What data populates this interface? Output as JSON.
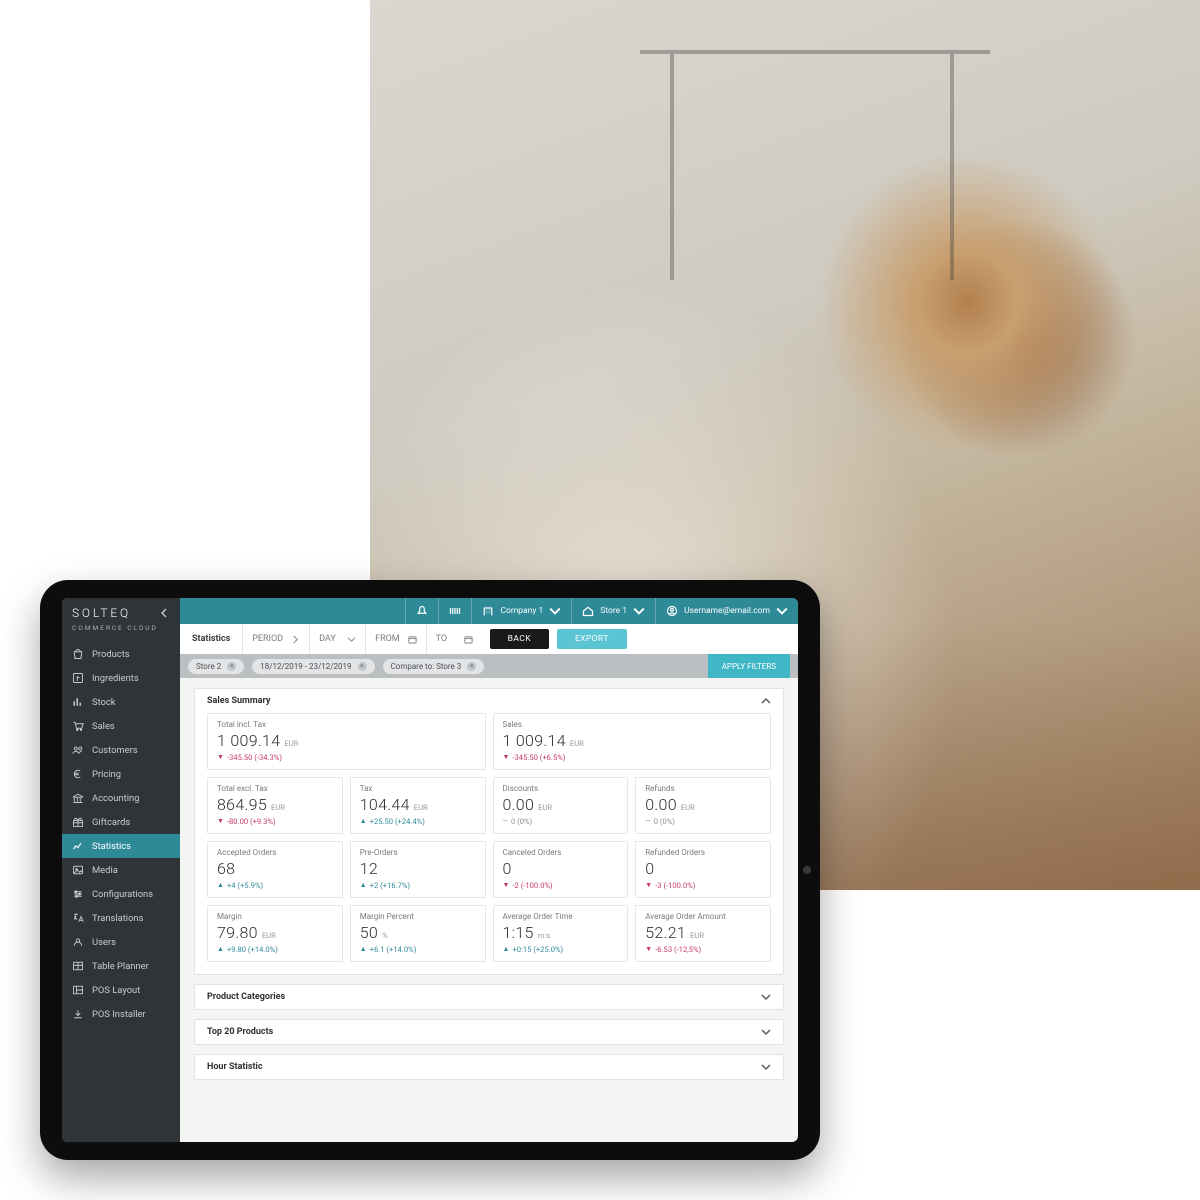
{
  "brand": {
    "title": "SOLTEQ",
    "subtitle": "COMMERCE CLOUD"
  },
  "sidebar": {
    "items": [
      {
        "label": "Products",
        "icon": "bag-icon"
      },
      {
        "label": "Ingredients",
        "icon": "ingredients-icon"
      },
      {
        "label": "Stock",
        "icon": "bars-icon"
      },
      {
        "label": "Sales",
        "icon": "cart-icon"
      },
      {
        "label": "Customers",
        "icon": "people-icon"
      },
      {
        "label": "Pricing",
        "icon": "euro-icon"
      },
      {
        "label": "Accounting",
        "icon": "bank-icon"
      },
      {
        "label": "Giftcards",
        "icon": "gift-icon"
      },
      {
        "label": "Statistics",
        "icon": "chart-line-icon"
      },
      {
        "label": "Media",
        "icon": "image-icon"
      },
      {
        "label": "Configurations",
        "icon": "sliders-icon"
      },
      {
        "label": "Translations",
        "icon": "translate-icon"
      },
      {
        "label": "Users",
        "icon": "user-icon"
      },
      {
        "label": "Table Planner",
        "icon": "table-icon"
      },
      {
        "label": "POS Layout",
        "icon": "layout-icon"
      },
      {
        "label": "POS Installer",
        "icon": "download-icon"
      }
    ],
    "active_index": 8
  },
  "topbar": {
    "company_label": "Company 1",
    "store_label": "Store 1",
    "user_label": "Username@email.com"
  },
  "filterbar": {
    "page_title": "Statistics",
    "period_label": "PERIOD",
    "day_label": "DAY",
    "from_label": "FROM",
    "to_label": "TO",
    "back_label": "BACK",
    "export_label": "EXPORT"
  },
  "chipbar": {
    "chips": [
      "Store 2",
      "18/12/2019 - 23/12/2019",
      "Compare to: Store 3"
    ],
    "apply_label": "APPLY FILTERS"
  },
  "panels": {
    "sales_summary": "Sales Summary",
    "product_categories": "Product Categories",
    "top20": "Top 20 Products",
    "hour": "Hour Statistic"
  },
  "metrics": {
    "row1": [
      {
        "label": "Total incl. Tax",
        "value": "1 009.14",
        "unit": "EUR",
        "delta": "-345.50 (-34.3%)",
        "dir": "down"
      },
      {
        "label": "Sales",
        "value": "1 009.14",
        "unit": "EUR",
        "delta": "-345.50 (+6.5%)",
        "dir": "down"
      }
    ],
    "row2": [
      {
        "label": "Total excl. Tax",
        "value": "864.95",
        "unit": "EUR",
        "delta": "-80.00 (+9.3%)",
        "dir": "down"
      },
      {
        "label": "Tax",
        "value": "104.44",
        "unit": "EUR",
        "delta": "+25.50 (+24.4%)",
        "dir": "up"
      },
      {
        "label": "Discounts",
        "value": "0.00",
        "unit": "EUR",
        "delta": "0 (0%)",
        "dir": "flat"
      },
      {
        "label": "Refunds",
        "value": "0.00",
        "unit": "EUR",
        "delta": "0 (0%)",
        "dir": "flat"
      }
    ],
    "row3": [
      {
        "label": "Accepted Orders",
        "value": "68",
        "unit": "",
        "delta": "+4 (+5.9%)",
        "dir": "up"
      },
      {
        "label": "Pre-Orders",
        "value": "12",
        "unit": "",
        "delta": "+2 (+16.7%)",
        "dir": "up"
      },
      {
        "label": "Canceled Orders",
        "value": "0",
        "unit": "",
        "delta": "-2 (-100.0%)",
        "dir": "down"
      },
      {
        "label": "Refunded Orders",
        "value": "0",
        "unit": "",
        "delta": "-3 (-100.0%)",
        "dir": "down"
      }
    ],
    "row4": [
      {
        "label": "Margin",
        "value": "79.80",
        "unit": "EUR",
        "delta": "+9.80 (+14.0%)",
        "dir": "up"
      },
      {
        "label": "Margin Percent",
        "value": "50",
        "unit": "%",
        "delta": "+6.1 (+14.0%)",
        "dir": "up"
      },
      {
        "label": "Average  Order Time",
        "value": "1:15",
        "unit": "m:s",
        "delta": "+0:15 (+25.0%)",
        "dir": "up"
      },
      {
        "label": "Average Order Amount",
        "value": "52.21",
        "unit": "EUR",
        "delta": "-6.53 (-12,5%)",
        "dir": "down"
      }
    ]
  }
}
